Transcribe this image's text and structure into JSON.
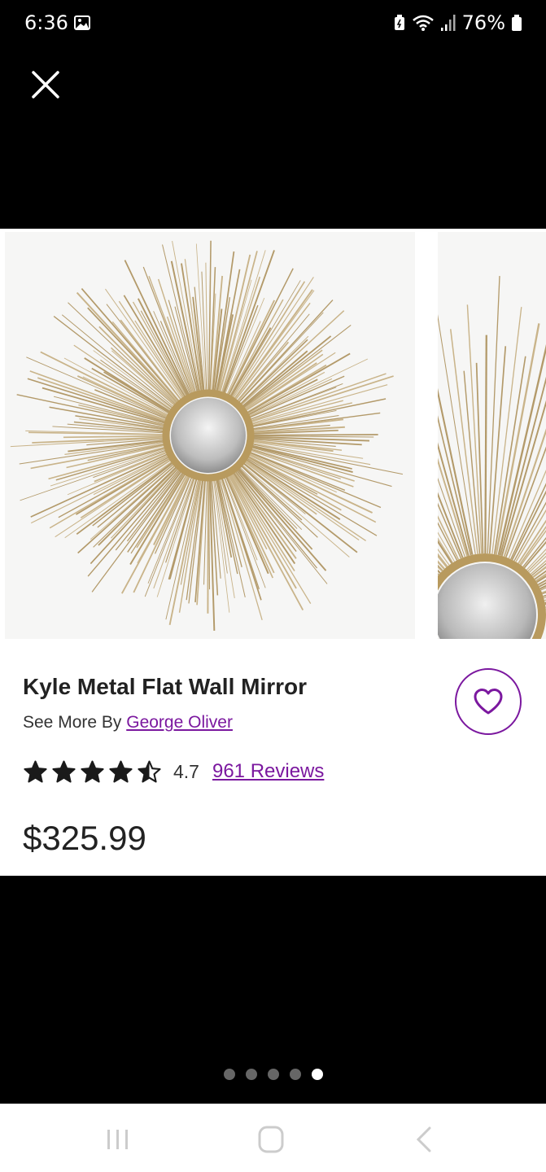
{
  "status_bar": {
    "time": "6:36",
    "battery": "76%"
  },
  "product": {
    "title": "Kyle Metal Flat Wall Mirror",
    "see_more_prefix": "See More By ",
    "brand": "George Oliver",
    "rating": "4.7",
    "rating_stars": 4.5,
    "reviews_label": "961 Reviews",
    "price": "$325.99"
  },
  "carousel": {
    "image_count": 5,
    "active_index": 4
  },
  "colors": {
    "accent": "#7b189f",
    "star": "#1a1a1a",
    "gold": "#c9b48a"
  },
  "icons": [
    "close-icon",
    "heart-icon",
    "star-icon",
    "gallery-icon",
    "wifi-icon",
    "signal-icon",
    "battery-icon",
    "recents-icon",
    "home-icon",
    "back-icon"
  ]
}
